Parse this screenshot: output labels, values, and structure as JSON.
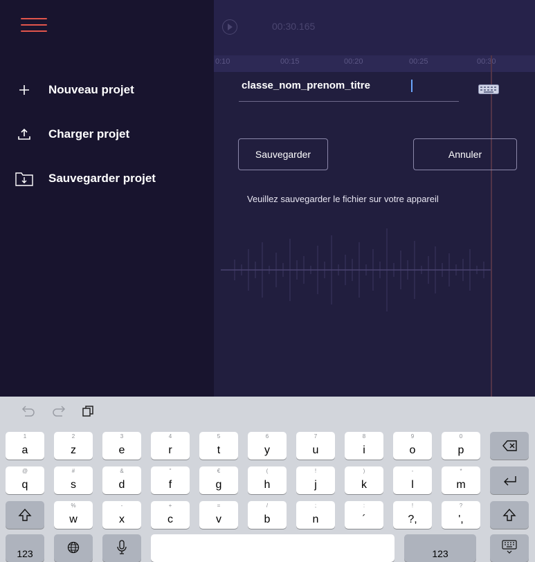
{
  "drawer": {
    "menu_icon": "hamburger-icon",
    "items": [
      {
        "icon": "plus-icon",
        "label": "Nouveau projet"
      },
      {
        "icon": "upload-icon",
        "label": "Charger projet"
      },
      {
        "icon": "folder-download-icon",
        "label": "Sauvegarder projet"
      }
    ]
  },
  "editor": {
    "time": "00:30.165",
    "ruler_ticks": [
      "0:10",
      "00:15",
      "00:20",
      "00:25",
      "00:30"
    ]
  },
  "save_dialog": {
    "filename": "classe_nom_prenom_titre",
    "save_label": "Sauvegarder",
    "cancel_label": "Annuler",
    "info": "Veuillez sauvegarder le fichier sur votre appareil"
  },
  "keyboard": {
    "tools": [
      "undo-icon",
      "redo-icon",
      "paste-icon"
    ],
    "row1": [
      [
        "1",
        "a"
      ],
      [
        "2",
        "z"
      ],
      [
        "3",
        "e"
      ],
      [
        "4",
        "r"
      ],
      [
        "5",
        "t"
      ],
      [
        "6",
        "y"
      ],
      [
        "7",
        "u"
      ],
      [
        "8",
        "i"
      ],
      [
        "9",
        "o"
      ],
      [
        "0",
        "p"
      ]
    ],
    "row2": [
      [
        "@",
        "q"
      ],
      [
        "#",
        "s"
      ],
      [
        "&",
        "d"
      ],
      [
        "\"",
        "f"
      ],
      [
        "€",
        "g"
      ],
      [
        "(",
        "h"
      ],
      [
        "!",
        "j"
      ],
      [
        ")",
        "k"
      ],
      [
        "-",
        "l"
      ],
      [
        "*",
        "m"
      ]
    ],
    "row3": [
      [
        "%",
        "w"
      ],
      [
        "-",
        "x"
      ],
      [
        "+",
        "c"
      ],
      [
        "=",
        "v"
      ],
      [
        "/",
        "b"
      ],
      [
        ";",
        "n"
      ],
      [
        ":",
        "´"
      ],
      [
        "!",
        "?,"
      ],
      [
        "?",
        "',"
      ]
    ],
    "numbers_label": "123",
    "numbers_label_right": "123",
    "colors": {
      "accent": "#e2554c",
      "drawer_bg": "#18142e",
      "main_bg": "#211e3e",
      "keyboard_bg": "#d2d5db"
    }
  }
}
